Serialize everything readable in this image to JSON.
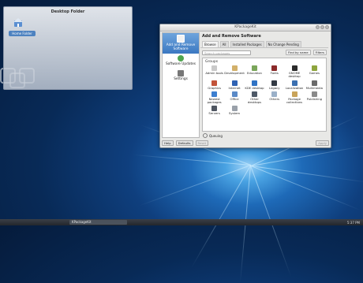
{
  "desktop": {
    "folder_title": "Desktop Folder",
    "home_label": "Home Folder"
  },
  "window": {
    "title": "KPackageKit"
  },
  "sidebar": {
    "items": [
      {
        "label": "Add and Remove Software",
        "icon": "package-add-icon",
        "active": true
      },
      {
        "label": "Software Updates",
        "icon": "update-icon",
        "active": false
      },
      {
        "label": "Settings",
        "icon": "settings-icon",
        "active": false
      }
    ]
  },
  "content": {
    "title": "Add and Remove Software",
    "tabs": [
      "Browse",
      "All",
      "Installed Packages",
      "No Change Pending"
    ],
    "search_placeholder": "Search packages",
    "sort_label": "Find by name",
    "filters_label": "Filters",
    "groups_label": "Groups",
    "groups": [
      {
        "label": "Admin tools",
        "color": "#c9c9c9"
      },
      {
        "label": "Development",
        "color": "#d2b06a"
      },
      {
        "label": "Education",
        "color": "#7aa65a"
      },
      {
        "label": "Fonts",
        "color": "#8b2a2a"
      },
      {
        "label": "GNOME desktop",
        "color": "#2b2b2b"
      },
      {
        "label": "Games",
        "color": "#8ea53d"
      },
      {
        "label": "Graphics",
        "color": "#c2543a"
      },
      {
        "label": "Internet",
        "color": "#2f62b3"
      },
      {
        "label": "KDE desktop",
        "color": "#2f72c4"
      },
      {
        "label": "Legacy",
        "color": "#333a44"
      },
      {
        "label": "Localization",
        "color": "#3a6fb0"
      },
      {
        "label": "Multimedia",
        "color": "#6a6a6a"
      },
      {
        "label": "Newest packages",
        "color": "#3d7fd0"
      },
      {
        "label": "Office",
        "color": "#5b8ac7"
      },
      {
        "label": "Other desktops",
        "color": "#4e5967"
      },
      {
        "label": "Others",
        "color": "#9ab0c8"
      },
      {
        "label": "Package collections",
        "color": "#c9a45a"
      },
      {
        "label": "Publishing",
        "color": "#8a8a8a"
      },
      {
        "label": "Servers",
        "color": "#4f5661"
      },
      {
        "label": "System",
        "color": "#9aa1aa"
      }
    ],
    "queue_label": "Queuing"
  },
  "bottom_bar": {
    "help_label": "Help",
    "defaults_label": "Defaults",
    "reset_label": "Reset",
    "apply_label": "Apply"
  },
  "taskbar": {
    "task_label": "KPackageKit",
    "clock": "5:37 PM"
  }
}
